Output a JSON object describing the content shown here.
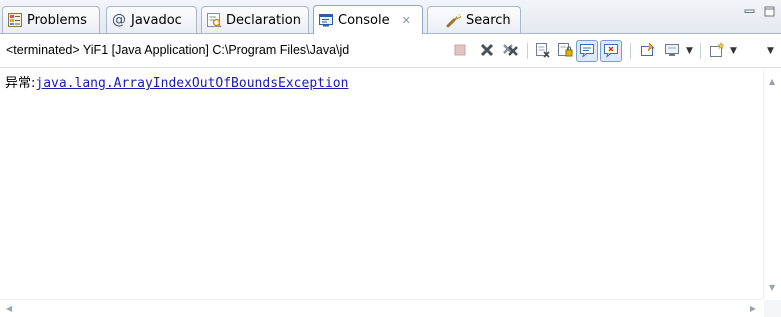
{
  "tabs": [
    {
      "label": "Problems",
      "icon": "problems-icon",
      "active": false
    },
    {
      "label": "Javadoc",
      "icon": "javadoc-at-icon",
      "active": false
    },
    {
      "label": "Declaration",
      "icon": "declaration-icon",
      "active": false
    },
    {
      "label": "Console",
      "icon": "console-icon",
      "active": true,
      "close": "✕"
    },
    {
      "label": "Search",
      "icon": "search-flashlight-icon",
      "active": false
    }
  ],
  "toolbar": {
    "process_label": "<terminated> YiF1 [Java Application] C:\\Program Files\\Java\\jd"
  },
  "console": {
    "prefix": "异常:",
    "link": "java.lang.ArrayIndexOutOfBoundsException"
  },
  "colors": {
    "link": "#1b1bb0",
    "tab_border": "#a9b7c9",
    "accent": "#3a6fb5"
  }
}
